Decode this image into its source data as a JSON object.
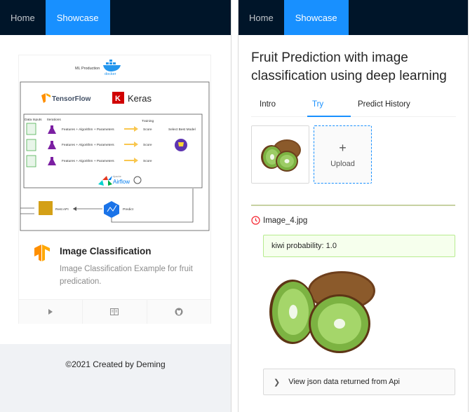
{
  "left_panel": {
    "nav": {
      "items": [
        {
          "label": "Home"
        },
        {
          "label": "Showcase"
        }
      ]
    },
    "card": {
      "cover": {
        "ml_production_label": "ML Production",
        "docker_label": "docker",
        "tensorflow_label": "TensorFlow",
        "keras_label": "Keras",
        "data_inputs_label": "Data Inputs",
        "iterations_label": "Iterations",
        "training_label": "Training",
        "select_best_model_label": "Select Best Model",
        "pipeline_rows": [
          {
            "text": "Features + Algorithm + Parameters",
            "score": "Score"
          },
          {
            "text": "Features + Algorithm + Parameters",
            "score": "Score"
          },
          {
            "text": "Features + Algorithm + Parameters",
            "score": "Score"
          }
        ],
        "airflow_label": "Airflow",
        "apache_label": "Apache",
        "rest_api_label": "Rest API",
        "predict_label": "Predict"
      },
      "title": "Image Classification",
      "description": "Image Classification Example for fruit predication.",
      "actions": [
        "play-icon",
        "read-icon",
        "github-icon"
      ]
    },
    "footer": {
      "text": "©2021 Created by Deming"
    }
  },
  "right_panel": {
    "nav": {
      "items": [
        {
          "label": "Home"
        },
        {
          "label": "Showcase"
        }
      ]
    },
    "title": "Fruit Prediction with image classification using deep learning",
    "tabs": [
      {
        "label": "Intro"
      },
      {
        "label": "Try"
      },
      {
        "label": "Predict History"
      }
    ],
    "active_tab": "Try",
    "upload": {
      "plus": "+",
      "label": "Upload"
    },
    "file_name": "Image_4.jpg",
    "prediction": "kiwi probability: 1.0",
    "collapse": {
      "label": "View json data returned from Api"
    }
  },
  "colors": {
    "nav_bg": "#001529",
    "accent": "#1890ff",
    "success_bg": "#f6ffed",
    "success_border": "#b7eb8f",
    "footer_bg": "#f0f2f5",
    "divider": "#c6d1a2",
    "tensorflow_orange": "#ff8f00",
    "keras_red": "#d00000"
  }
}
